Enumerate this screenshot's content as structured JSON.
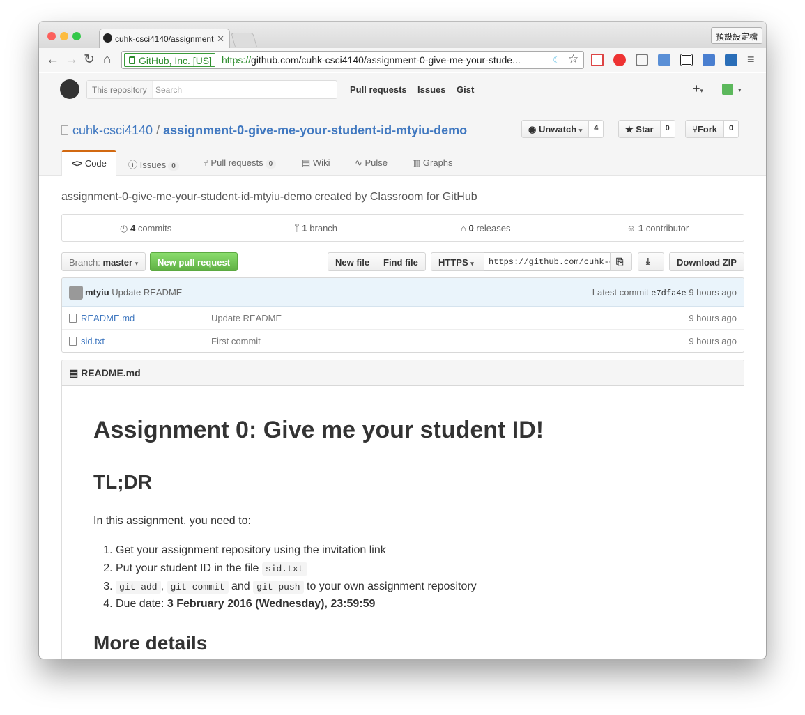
{
  "browser": {
    "tab_title": "cuhk-csci4140/assignment",
    "profile_button": "預設設定檔",
    "ev_cert": "GitHub, Inc. [US]",
    "url_protocol": "https://",
    "url_rest": "github.com/cuhk-csci4140/assignment-0-give-me-your-stude..."
  },
  "header": {
    "search_scope": "This repository",
    "search_placeholder": "Search",
    "nav": [
      "Pull requests",
      "Issues",
      "Gist"
    ],
    "plus": "+"
  },
  "repo": {
    "owner": "cuhk-csci4140",
    "separator": "/",
    "name": "assignment-0-give-me-your-student-id-mtyiu-demo",
    "watch_label": "Unwatch",
    "watch_count": "4",
    "star_label": "Star",
    "star_count": "0",
    "fork_label": "Fork",
    "fork_count": "0",
    "tabs": [
      {
        "label": "Code"
      },
      {
        "label": "Issues",
        "count": "0"
      },
      {
        "label": "Pull requests",
        "count": "0"
      },
      {
        "label": "Wiki"
      },
      {
        "label": "Pulse"
      },
      {
        "label": "Graphs"
      }
    ],
    "description": "assignment-0-give-me-your-student-id-mtyiu-demo created by Classroom for GitHub"
  },
  "summary": {
    "commits_num": "4",
    "commits_label": "commits",
    "branch_num": "1",
    "branch_label": "branch",
    "releases_num": "0",
    "releases_label": "releases",
    "contributor_num": "1",
    "contributor_label": "contributor"
  },
  "filebar": {
    "branch_prefix": "Branch:",
    "branch_name": "master",
    "new_pr": "New pull request",
    "new_file": "New file",
    "find_file": "Find file",
    "protocol": "HTTPS",
    "clone_url": "https://github.com/cuhk-c",
    "download_zip": "Download ZIP"
  },
  "commit": {
    "author": "mtyiu",
    "message": "Update README",
    "latest_label": "Latest commit",
    "sha": "e7dfa4e",
    "age": "9 hours ago"
  },
  "files": [
    {
      "name": "README.md",
      "message": "Update README",
      "age": "9 hours ago"
    },
    {
      "name": "sid.txt",
      "message": "First commit",
      "age": "9 hours ago"
    }
  ],
  "readme": {
    "filename": "README.md",
    "h1": "Assignment 0: Give me your student ID!",
    "h2_tldr": "TL;DR",
    "intro": "In this assignment, you need to:",
    "li1": "Get your assignment repository using the invitation link",
    "li2_text": "Put your student ID in the file",
    "li2_code": "sid.txt",
    "li3_code1": "git add",
    "li3_code2": "git commit",
    "li3_and": "and",
    "li3_code3": "git push",
    "li3_text": "to your own assignment repository",
    "li4_text": "Due date:",
    "li4_bold": "3 February 2016 (Wednesday), 23:59:59",
    "h2_more": "More details"
  },
  "colors": {
    "link": "#4078c0",
    "green_button": "#60b044",
    "active_tab_border": "#d26911"
  }
}
